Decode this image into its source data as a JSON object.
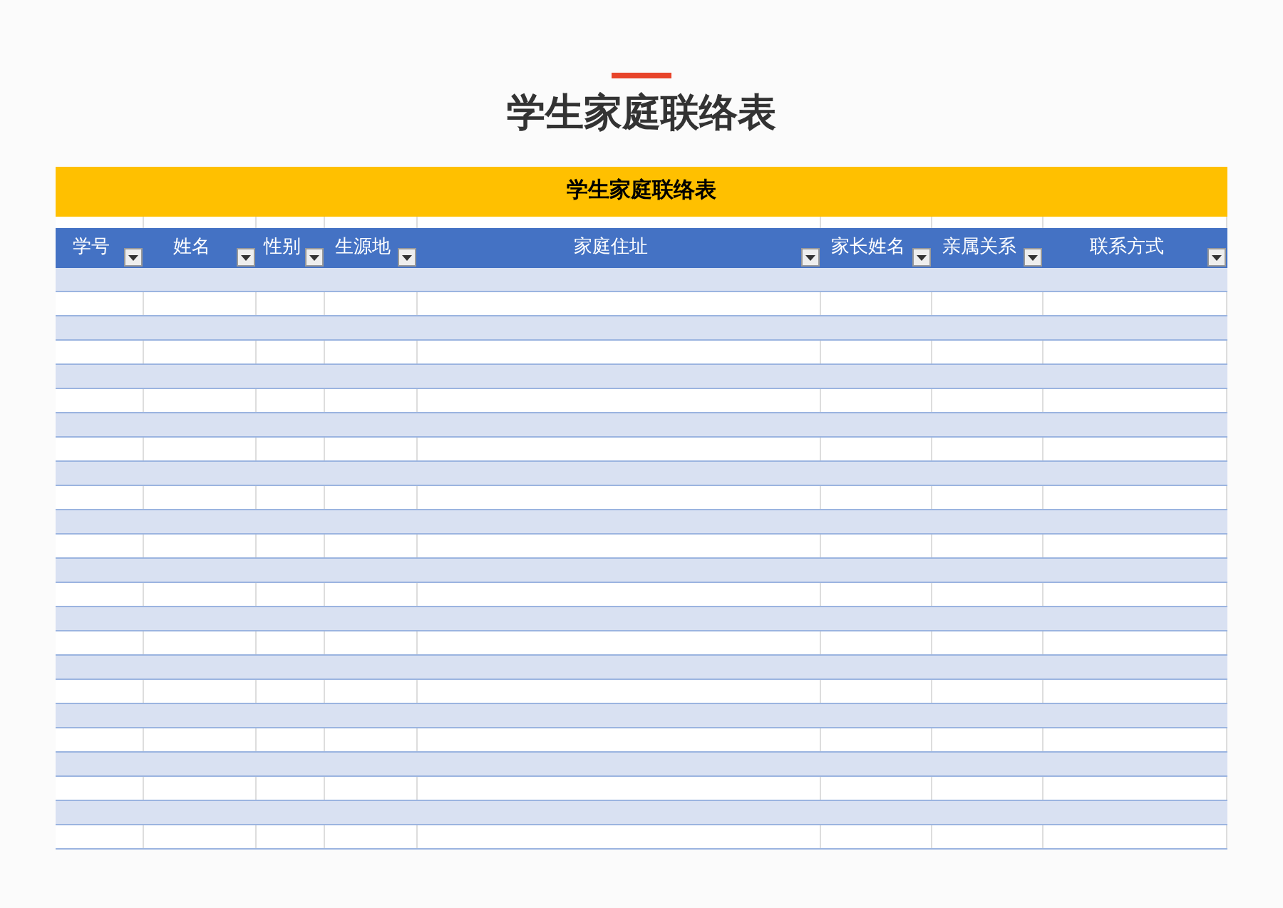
{
  "page_title": "学生家庭联络表",
  "table": {
    "title": "学生家庭联络表",
    "columns": [
      {
        "label": "学号",
        "filter": true
      },
      {
        "label": "姓名",
        "filter": true
      },
      {
        "label": "性别",
        "filter": true
      },
      {
        "label": "生源地",
        "filter": true
      },
      {
        "label": "家庭住址",
        "filter": true
      },
      {
        "label": "家长姓名",
        "filter": true
      },
      {
        "label": "亲属关系",
        "filter": true
      },
      {
        "label": "联系方式",
        "filter": true
      }
    ]
  }
}
